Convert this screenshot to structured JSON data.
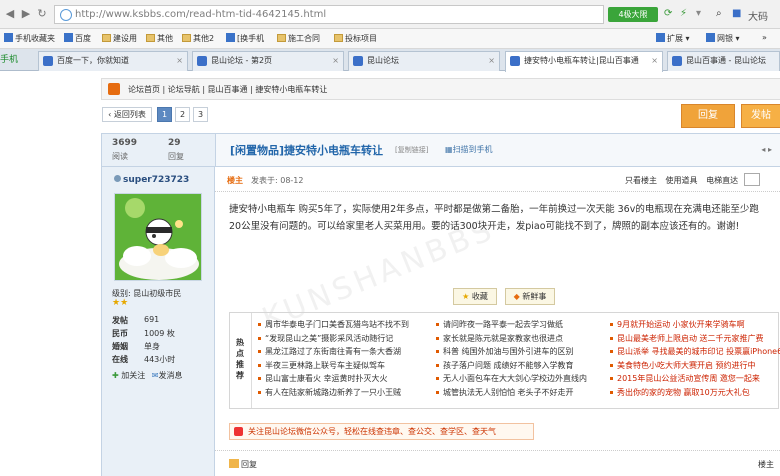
{
  "browser": {
    "url": "http://www.ksbbs.com/read-htm-tid-4642145.html",
    "fast_label": "4极大限",
    "user_label": "大码",
    "icons": [
      "back-icon",
      "forward-icon",
      "refresh-icon",
      "home-icon",
      "lightning-icon",
      "user-icon"
    ]
  },
  "favorites": [
    {
      "label": "手机收藏夹"
    },
    {
      "label": "百度"
    },
    {
      "label": "建设用"
    },
    {
      "label": "其他"
    },
    {
      "label": "其他2"
    },
    {
      "label": "[换手机"
    },
    {
      "label": "施工合同"
    },
    {
      "label": "投标项目"
    }
  ],
  "favorites_right": {
    "ext": "扩展",
    "bank": "网银",
    "more": "»"
  },
  "tabs": [
    {
      "label": "百度一下，你就知道"
    },
    {
      "label": "昆山论坛 - 第2页"
    },
    {
      "label": "昆山论坛"
    },
    {
      "label": "捷安特小电瓶车转让|昆山百事通"
    },
    {
      "label": "昆山百事通 - 昆山论坛"
    }
  ],
  "green_tab": "手机",
  "breadcrumb": "论坛首页 | 论坛导航 | 昆山百事通 | 捷安特小电瓶车转让",
  "pager": {
    "back": "‹ 返回列表",
    "pages": [
      "1",
      "2",
      "3"
    ]
  },
  "buttons": {
    "reply": "回复",
    "post": "发帖"
  },
  "stats": {
    "views": "3699",
    "views_label": "阅读",
    "replies": "29",
    "replies_label": "回复"
  },
  "thread": {
    "title": "[闲置物品]捷安特小电瓶车转让",
    "copy_link": "[复制链接]",
    "scan": "扫描到手机",
    "nav_arrows": "◂ ▸"
  },
  "user": {
    "name": "super723723",
    "level": "级别: 昆山初级市民",
    "stars": "★★",
    "rows": [
      {
        "label": "发帖",
        "value": "691"
      },
      {
        "label": "民币",
        "value": "1009 枚"
      },
      {
        "label": "婚姻",
        "value": "单身"
      },
      {
        "label": "在线",
        "value": "443小时"
      }
    ],
    "add_follow": "加关注",
    "send_msg": "发消息"
  },
  "post": {
    "floor_tag": "楼主",
    "time": "发表于: 08-12",
    "only_op": "只看楼主",
    "use_tool": "使用道具",
    "goto_floor": "电梯直达",
    "content": "捷安特小电瓶车 购买5年了，实际使用2年多点，平时都是做第二备胎，一年前换过一次天能 36v的电瓶现在充满电还能至少跑20公里没有问题的。可以给家里老人买菜用用。要的话300块开走，发piao可能找不到了，牌照的副本应该还有的。谢谢!",
    "collect": "收藏",
    "share": "新鲜事"
  },
  "hot": {
    "label": "热点推荐",
    "col1": [
      "周市华泰电子门口美香瓦猎鸟站不找不到",
      "“发现昆山之美”摄影采风活动随行记",
      "黑龙江路过了东街南往青有一条大香湖",
      "半夜三更林路上联号车主疑似驾车",
      "昆山富士康看火 幸运黄时扑灭大火",
      "有人在陆家新城路边新养了一只小王贼"
    ],
    "col2": [
      "请问昨夜一路平泰一起去学习做纸",
      "家长就是陈元就是家教家也很进点",
      "科普 纯国外加油与国外引进车的区别",
      "孩子落户问题 成绩好不能够入学教育",
      "无人小面包车在大大剑心学校边外直线内",
      "城管执法无人别怕怕 老头子不好走开"
    ],
    "col3": [
      "9月就开始运动 小家伙开来学骑车啊",
      "昆山最美老师上限启动 送二千元家推广费",
      "昆山派举 寻找最美的城市印记 投票赢iPhone6s",
      "美食特色小吃大师大赛开启 预约进行中",
      "2015年昆山公益活动宣传周 邀您一起来",
      "秀出你的家的宠物 赢取10万元大礼包"
    ]
  },
  "follow": "关注昆山论坛微信公众号，轻松在线查违章、查公交、查学区、查天气",
  "bottom": {
    "reply": "回复",
    "floor": "楼主"
  },
  "watermark": "KUNSHANBBS",
  "colors": {
    "accent": "#e66c10",
    "link": "#2266aa",
    "reply_btn": "#f0a33a"
  }
}
